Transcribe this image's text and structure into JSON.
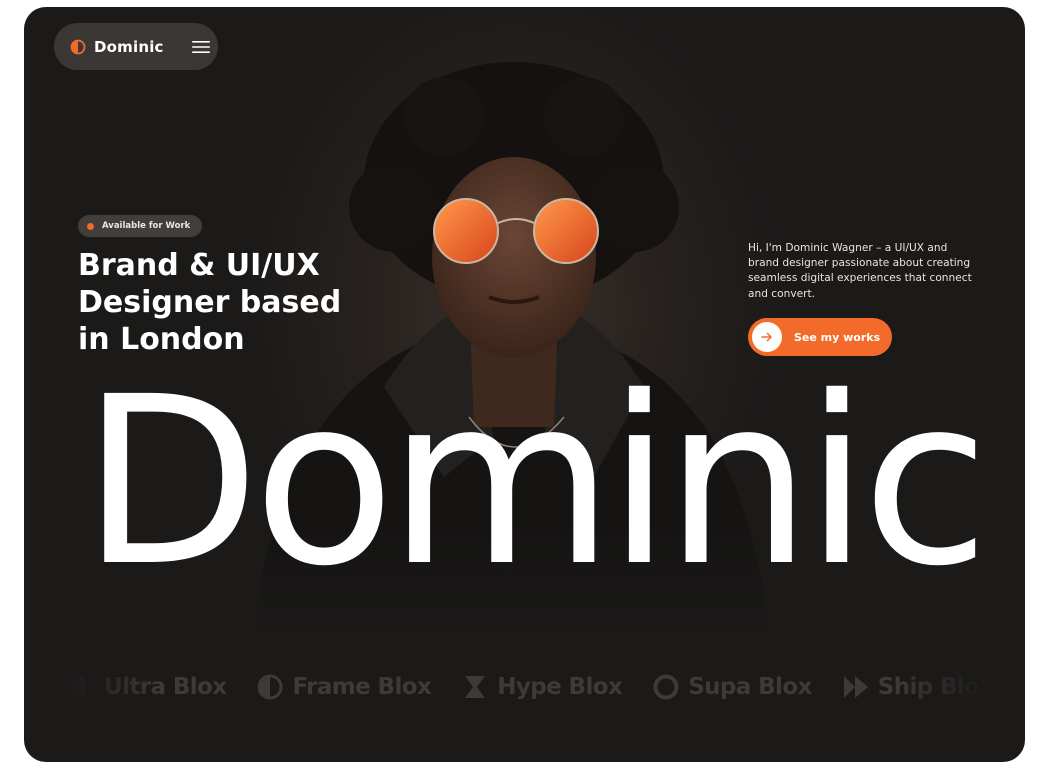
{
  "colors": {
    "accent": "#f26b2a",
    "background": "#1b1a19",
    "text": "#ffffff"
  },
  "nav": {
    "logo_text": "Dominic",
    "logo_icon": "half-circle-icon",
    "menu_icon": "hamburger-icon"
  },
  "hero": {
    "badge": "Available for Work",
    "headline_lines": [
      "Brand & UI/UX",
      "Designer based",
      "in London"
    ],
    "intro": "Hi, I'm Dominic Wagner – a UI/UX and brand designer passionate about creating seamless digital experiences that connect and convert.",
    "cta_label": "See my works",
    "cta_icon": "arrow-right-icon",
    "big_name": "Dominic"
  },
  "clients": [
    {
      "name": "Ultra Blox",
      "icon": "bars-icon"
    },
    {
      "name": "Frame Blox",
      "icon": "half-circle-icon"
    },
    {
      "name": "Hype Blox",
      "icon": "hourglass-icon"
    },
    {
      "name": "Supa Blox",
      "icon": "ring-icon"
    },
    {
      "name": "Ship Blox",
      "icon": "double-chevron-icon"
    }
  ]
}
